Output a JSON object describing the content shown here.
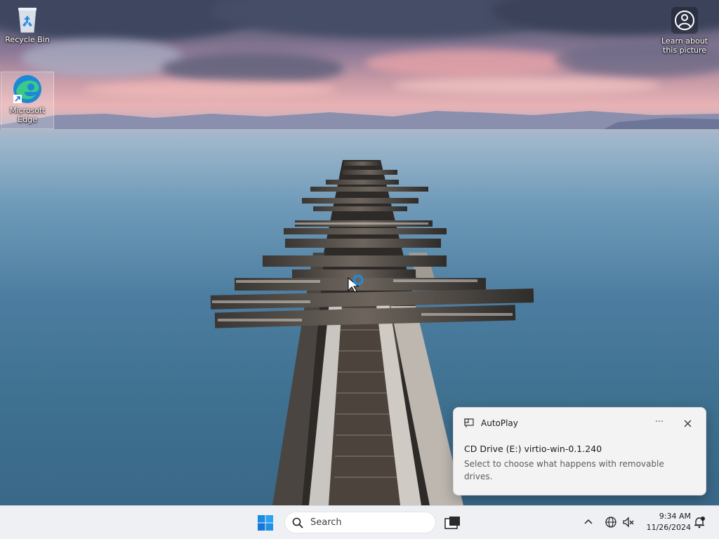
{
  "desktop": {
    "icons": [
      {
        "label": "Recycle Bin",
        "icon": "recycle-bin-icon"
      },
      {
        "label": "Microsoft Edge",
        "icon": "edge-icon"
      }
    ],
    "learn_about": "Learn about this picture"
  },
  "toast": {
    "app": "AutoPlay",
    "title": "CD Drive (E:) virtio-win-0.1.240",
    "body": "Select to choose what happens with removable drives.",
    "more_label": "···"
  },
  "taskbar": {
    "search_placeholder": "Search",
    "time": "9:34 AM",
    "date": "11/26/2024"
  },
  "colors": {
    "taskbar_bg": "#eef0f4",
    "toast_bg": "#f3f3f3",
    "start_accent": "#1a8ce6"
  }
}
